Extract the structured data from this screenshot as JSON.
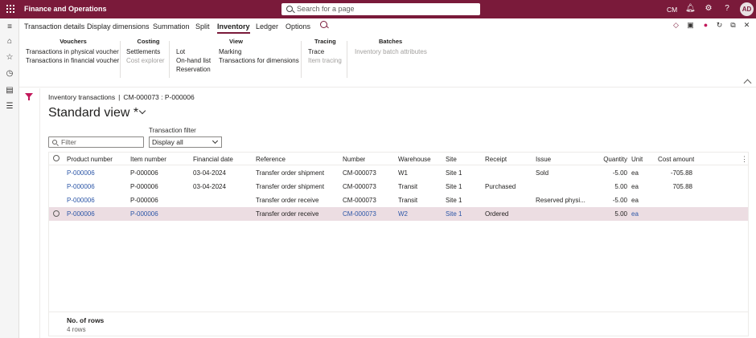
{
  "app": {
    "title": "Finance and Operations",
    "company": "CM",
    "avatar_initials": "AD"
  },
  "search": {
    "placeholder": "Search for a page"
  },
  "menu": {
    "tabs": [
      "Transaction details",
      "Display dimensions",
      "Summation",
      "Split",
      "Inventory",
      "Ledger",
      "Options"
    ],
    "active": "Inventory"
  },
  "ribbon": {
    "groups": [
      {
        "title": "Vouchers",
        "items": [
          {
            "label": "Transactions in physical voucher",
            "enabled": true
          },
          {
            "label": "Transactions in financial voucher",
            "enabled": true
          }
        ]
      },
      {
        "title": "Costing",
        "items": [
          {
            "label": "Settlements",
            "enabled": true
          },
          {
            "label": "Cost explorer",
            "enabled": false
          }
        ]
      },
      {
        "title": "View",
        "items": [
          {
            "label": "Lot",
            "enabled": true
          },
          {
            "label": "On-hand list",
            "enabled": true
          },
          {
            "label": "Reservation",
            "enabled": true
          },
          {
            "label": "Marking",
            "enabled": true
          },
          {
            "label": "Transactions for dimensions",
            "enabled": true
          }
        ]
      },
      {
        "title": "Tracing",
        "items": [
          {
            "label": "Trace",
            "enabled": true
          },
          {
            "label": "Item tracing",
            "enabled": false
          }
        ]
      },
      {
        "title": "Batches",
        "items": [
          {
            "label": "Inventory batch attributes",
            "enabled": false
          }
        ]
      }
    ]
  },
  "page": {
    "breadcrumb_1": "Inventory transactions",
    "breadcrumb_sep": "|",
    "breadcrumb_2": "CM-000073 : P-000006",
    "view_title": "Standard view *",
    "filter_placeholder": "Filter",
    "transaction_filter_label": "Transaction filter",
    "transaction_filter_value": "Display all"
  },
  "grid": {
    "columns": [
      "Product number",
      "Item number",
      "Financial date",
      "Reference",
      "Number",
      "Warehouse",
      "Site",
      "Receipt",
      "Issue",
      "Quantity",
      "Unit",
      "Cost amount"
    ],
    "rows": [
      {
        "product": "P-000006",
        "item": "P-000006",
        "date": "03-04-2024",
        "reference": "Transfer order shipment",
        "number": "CM-000073",
        "warehouse": "W1",
        "site": "Site 1",
        "receipt": "",
        "issue": "Sold",
        "quantity": "-5.00",
        "unit": "ea",
        "cost": "-705.88"
      },
      {
        "product": "P-000006",
        "item": "P-000006",
        "date": "03-04-2024",
        "reference": "Transfer order shipment",
        "number": "CM-000073",
        "warehouse": "Transit",
        "site": "Site 1",
        "receipt": "Purchased",
        "issue": "",
        "quantity": "5.00",
        "unit": "ea",
        "cost": "705.88"
      },
      {
        "product": "P-000006",
        "item": "P-000006",
        "date": "",
        "reference": "Transfer order receive",
        "number": "CM-000073",
        "warehouse": "Transit",
        "site": "Site 1",
        "receipt": "",
        "issue": "Reserved physi...",
        "quantity": "-5.00",
        "unit": "ea",
        "cost": ""
      },
      {
        "product": "P-000006",
        "item": "P-000006",
        "date": "",
        "reference": "Transfer order receive",
        "number": "CM-000073",
        "warehouse": "W2",
        "site": "Site 1",
        "receipt": "Ordered",
        "issue": "",
        "quantity": "5.00",
        "unit": "ea",
        "cost": ""
      }
    ],
    "selected_row": 3,
    "footer_label": "No. of rows",
    "footer_value": "4 rows"
  },
  "colors": {
    "brand": "#7a1a3a",
    "link": "#2c56a7",
    "selected_row": "#ecdde2"
  }
}
